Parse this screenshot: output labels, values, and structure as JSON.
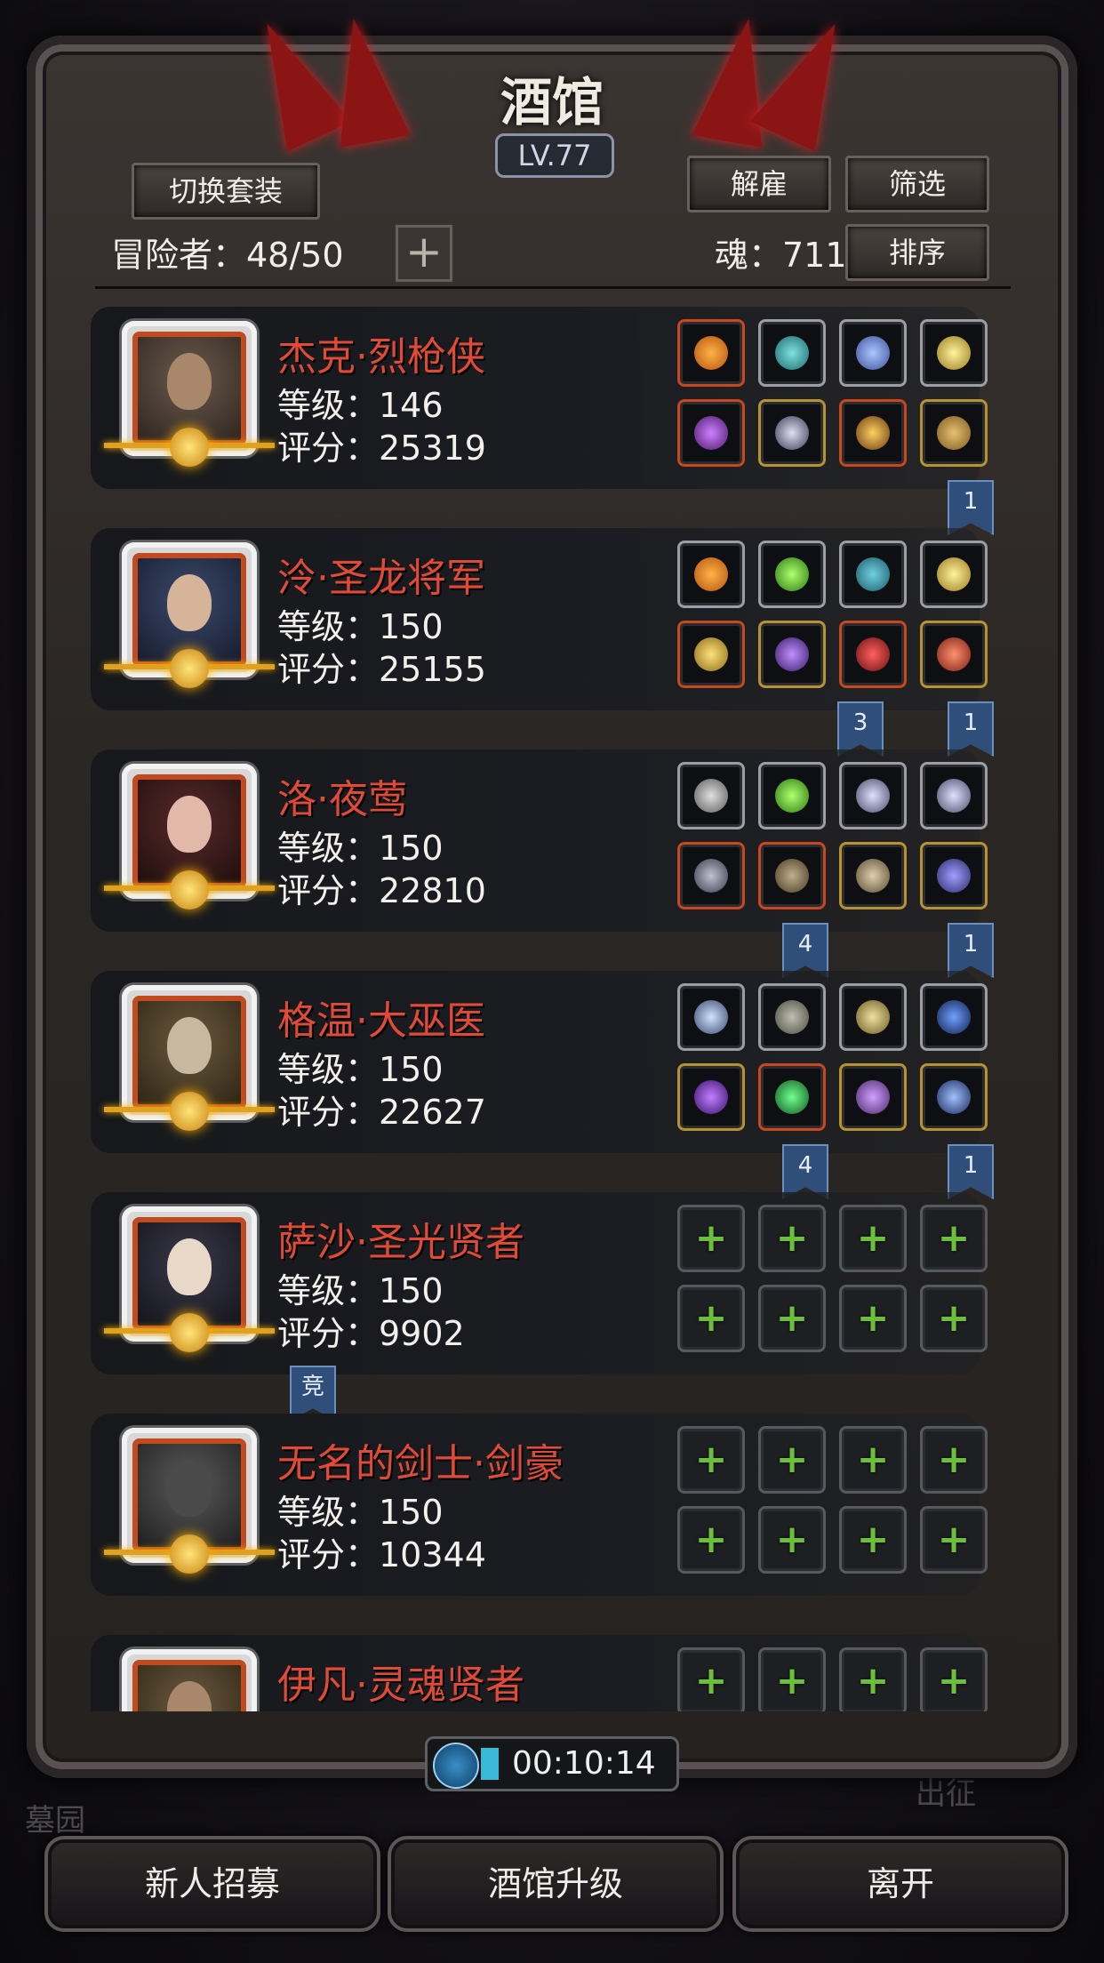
{
  "title": "酒馆",
  "level": "LV.77",
  "buttons": {
    "switch_outfit": "切换套装",
    "dismiss": "解雇",
    "filter": "筛选",
    "sort": "排序",
    "add": "+"
  },
  "adventurers_label": "冒险者：48/50",
  "soul_label": "魂：711",
  "heroes": [
    {
      "name": "杰克·烈枪侠",
      "level": "等级：146",
      "score": "评分：25319"
    },
    {
      "name": "泠·圣龙将军",
      "level": "等级：150",
      "score": "评分：25155"
    },
    {
      "name": "洛·夜莺",
      "level": "等级：150",
      "score": "评分：22810"
    },
    {
      "name": "格温·大巫医",
      "level": "等级：150",
      "score": "评分：22627"
    },
    {
      "name": "萨沙·圣光贤者",
      "level": "等级：150",
      "score": "评分：9902"
    },
    {
      "name": "无名的剑士·剑豪",
      "level": "等级：150",
      "score": "评分：10344"
    },
    {
      "name": "伊凡·灵魂贤者",
      "level": "",
      "score": ""
    }
  ],
  "ribbons": [
    "1",
    "3",
    "1",
    "4",
    "1",
    "4",
    "1",
    "竞"
  ],
  "timer": "00:10:14",
  "bottom": {
    "recruit": "新人招募",
    "upgrade": "酒馆升级",
    "leave": "离开"
  },
  "background_text": {
    "left": "墓园",
    "right": "出征"
  },
  "colors": {
    "hero_name": "#e24a38",
    "ribbon": "#2f4f7a",
    "empty_plus": "#6cbf3a"
  }
}
